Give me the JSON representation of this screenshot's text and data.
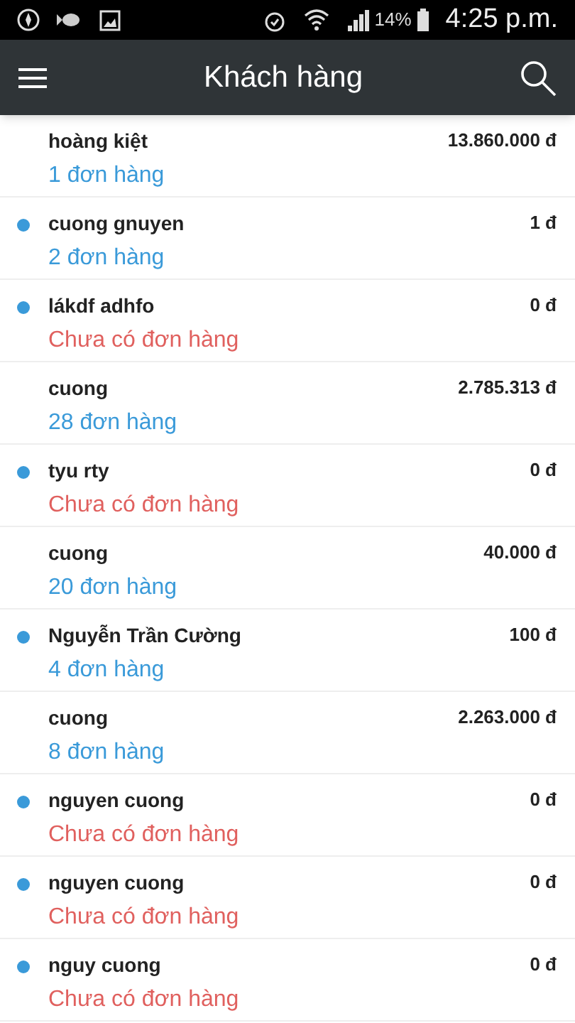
{
  "status_bar": {
    "battery": "14%",
    "time": "4:25 p.m."
  },
  "app_bar": {
    "title": "Khách hàng"
  },
  "customers": [
    {
      "name": "hoàng kiệt",
      "amount": "13.860.000 đ",
      "orders": "1 đơn hàng",
      "kind": "orders",
      "marked": false
    },
    {
      "name": "cuong gnuyen",
      "amount": "1 đ",
      "orders": "2 đơn hàng",
      "kind": "orders",
      "marked": true
    },
    {
      "name": "lákdf adhfo",
      "amount": "0 đ",
      "orders": "Chưa có đơn hàng",
      "kind": "none",
      "marked": true
    },
    {
      "name": "cuong",
      "amount": "2.785.313 đ",
      "orders": "28 đơn hàng",
      "kind": "orders",
      "marked": false
    },
    {
      "name": "tyu rty",
      "amount": "0 đ",
      "orders": "Chưa có đơn hàng",
      "kind": "none",
      "marked": true
    },
    {
      "name": "cuong",
      "amount": "40.000 đ",
      "orders": "20 đơn hàng",
      "kind": "orders",
      "marked": false
    },
    {
      "name": "Nguyễn Trần Cường",
      "amount": "100 đ",
      "orders": "4 đơn hàng",
      "kind": "orders",
      "marked": true
    },
    {
      "name": "cuong",
      "amount": "2.263.000 đ",
      "orders": "8 đơn hàng",
      "kind": "orders",
      "marked": false
    },
    {
      "name": "nguyen cuong",
      "amount": "0 đ",
      "orders": "Chưa có đơn hàng",
      "kind": "none",
      "marked": true
    },
    {
      "name": "nguyen cuong",
      "amount": "0 đ",
      "orders": "Chưa có đơn hàng",
      "kind": "none",
      "marked": true
    },
    {
      "name": "nguy cuong",
      "amount": "0 đ",
      "orders": "Chưa có đơn hàng",
      "kind": "none",
      "marked": true
    }
  ]
}
